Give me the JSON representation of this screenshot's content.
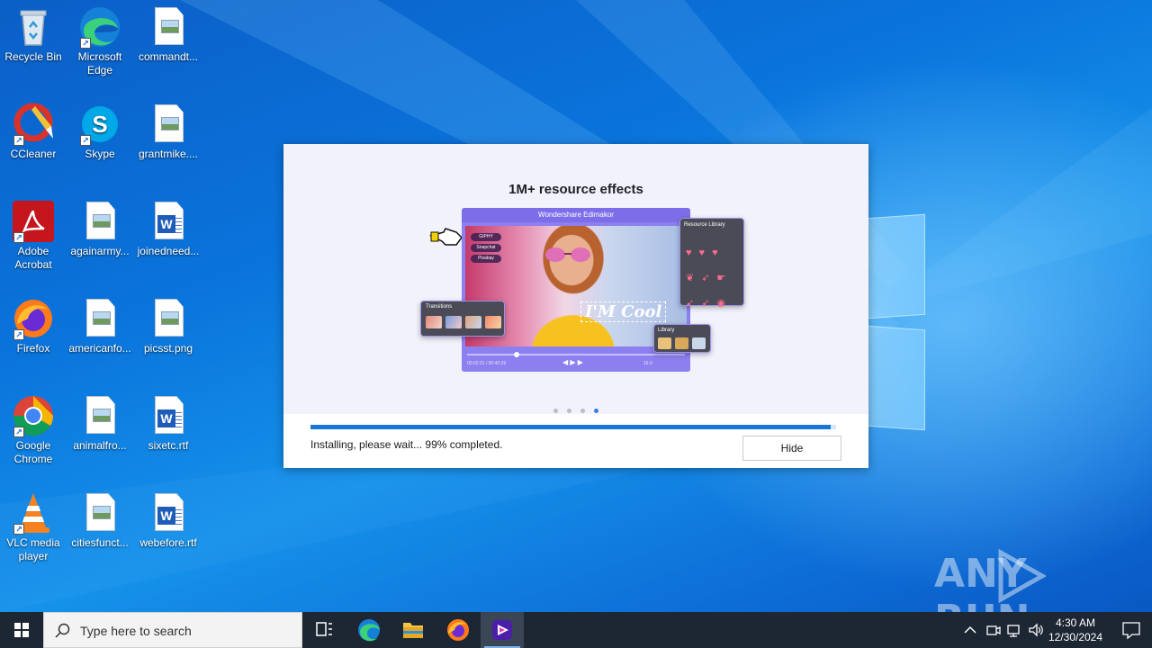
{
  "desktop": {
    "icons": [
      {
        "label": "Recycle Bin"
      },
      {
        "label": "Microsoft Edge"
      },
      {
        "label": "commandt..."
      },
      {
        "label": "CCleaner"
      },
      {
        "label": "Skype"
      },
      {
        "label": "grantmike...."
      },
      {
        "label": "Adobe Acrobat"
      },
      {
        "label": "againarmy..."
      },
      {
        "label": "joinedneed..."
      },
      {
        "label": "Firefox"
      },
      {
        "label": "americanfo..."
      },
      {
        "label": "picsst.png"
      },
      {
        "label": "Google Chrome"
      },
      {
        "label": "animalfro..."
      },
      {
        "label": "sixetc.rtf"
      },
      {
        "label": "VLC media player"
      },
      {
        "label": "citiesfunct..."
      },
      {
        "label": "webefore.rtf"
      }
    ],
    "watermark": "ANY RUN"
  },
  "installer": {
    "banner_title": "1M+ resource effects",
    "mock": {
      "app_title": "Wondershare Edimakor",
      "chips": [
        "GIPHY",
        "Snapchat",
        "Pixabay"
      ],
      "overlay_text": "I'M Cool",
      "transitions_label": "Transitions",
      "library_label": "Library",
      "resource_label": "Resource Library",
      "timecode": "00:02:21 / 00:42:29",
      "zoom": "16.0"
    },
    "slides": {
      "count": 4,
      "active_index": 3
    },
    "progress": 0.99,
    "status_text": "Installing, please wait... 99% completed.",
    "hide_label": "Hide"
  },
  "taskbar": {
    "search_placeholder": "Type here to search",
    "clock_time": "4:30 AM",
    "clock_date": "12/30/2024"
  },
  "colors": {
    "accent": "#1878d8",
    "taskbar": "#1d2633",
    "desktop": "#0a74dc"
  }
}
